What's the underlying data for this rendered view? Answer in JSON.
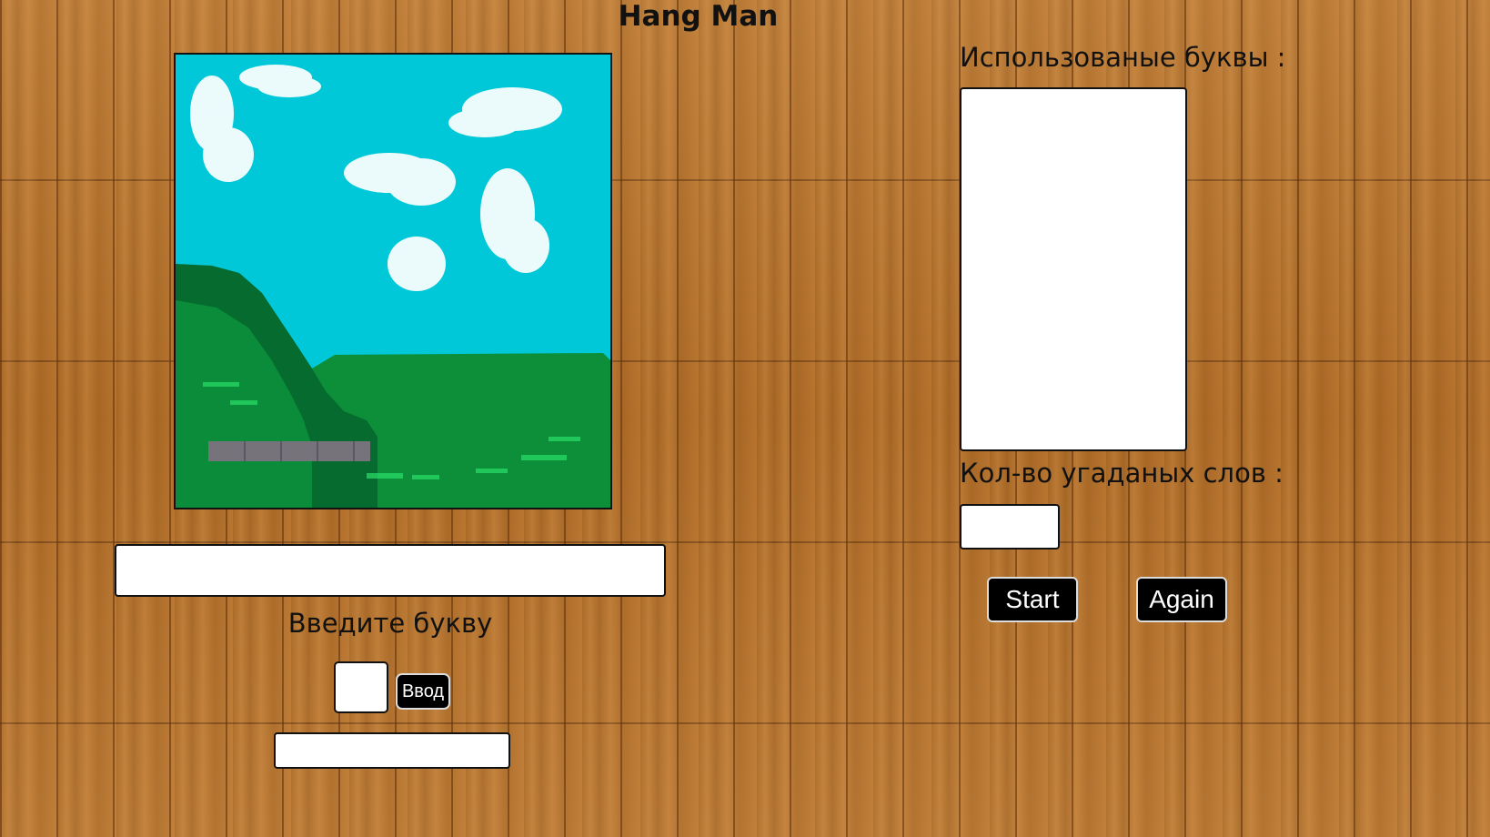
{
  "header": {
    "title": "Hang Man"
  },
  "left_panel": {
    "scene_image": "hangman-scene-image",
    "prompt": "Введите букву",
    "enter_button_label": "Ввод"
  },
  "right_panel": {
    "used_letters_label": "Использованые буквы :",
    "guessed_count_label": "Кол-во угаданых слов :",
    "start_button_label": "Start",
    "again_button_label": "Again"
  },
  "colors": {
    "sky": "#00c8d8",
    "hill_dark": "#056b2e",
    "grass": "#0d8f3a",
    "button": "#000000"
  }
}
